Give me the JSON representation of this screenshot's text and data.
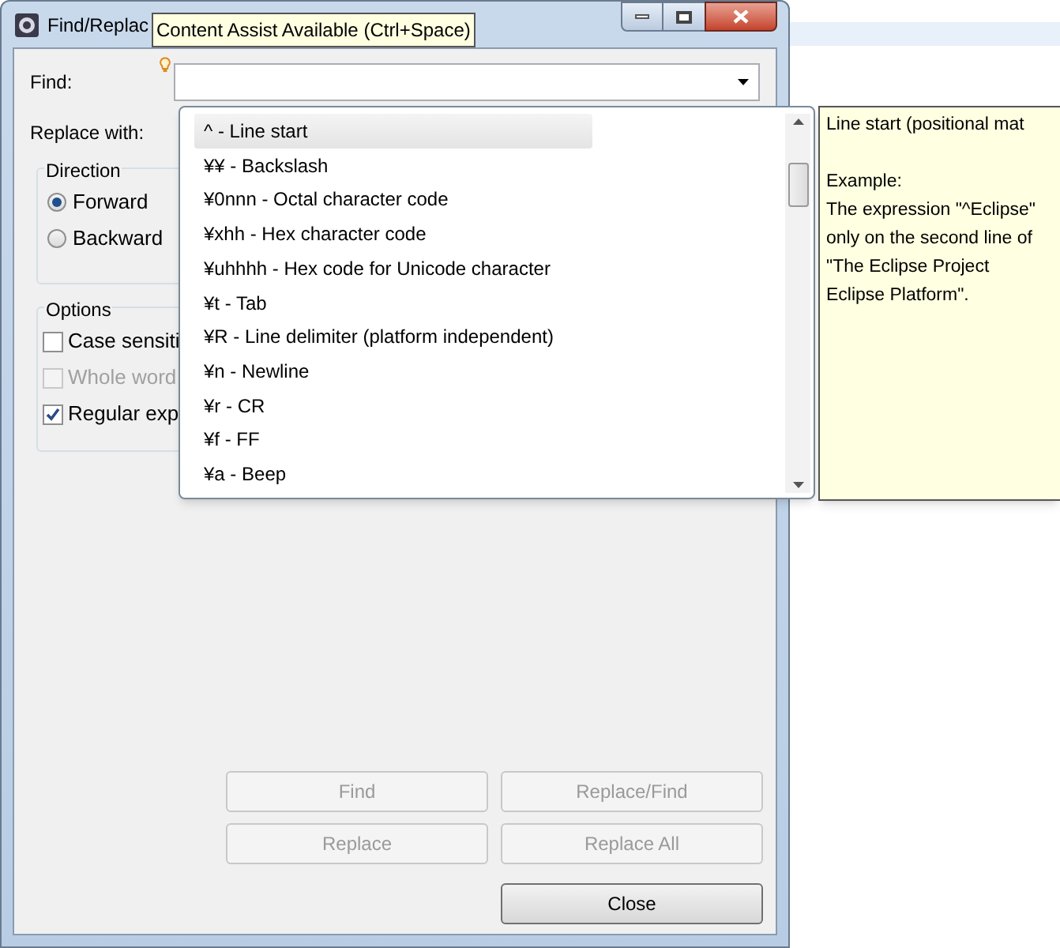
{
  "window": {
    "title": "Find/Replac"
  },
  "content_assist_tooltip": "Content Assist Available (Ctrl+Space)",
  "find": {
    "label": "Find:"
  },
  "replace": {
    "label": "Replace with:"
  },
  "direction": {
    "title": "Direction",
    "options": [
      {
        "label": "Forward",
        "selected": true
      },
      {
        "label": "Backward",
        "selected": false
      }
    ]
  },
  "options": {
    "title": "Options",
    "items": [
      {
        "label": "Case sensiti",
        "checked": false,
        "disabled": false
      },
      {
        "label": "Whole word",
        "checked": false,
        "disabled": true
      },
      {
        "label": "Regular exp",
        "checked": true,
        "disabled": false
      }
    ]
  },
  "buttons": [
    {
      "label": "Find",
      "disabled": true
    },
    {
      "label": "Replace/Find",
      "disabled": true
    },
    {
      "label": "Replace",
      "disabled": true
    },
    {
      "label": "Replace All",
      "disabled": true
    },
    {
      "label": "Close",
      "disabled": false
    }
  ],
  "proposals": [
    {
      "label": "^ - Line start",
      "selected": true
    },
    {
      "label": "¥¥ - Backslash",
      "selected": false
    },
    {
      "label": "¥0nnn - Octal character code",
      "selected": false
    },
    {
      "label": "¥xhh - Hex character code",
      "selected": false
    },
    {
      "label": "¥uhhhh - Hex code for Unicode character",
      "selected": false
    },
    {
      "label": "¥t - Tab",
      "selected": false
    },
    {
      "label": "¥R - Line delimiter (platform independent)",
      "selected": false
    },
    {
      "label": "¥n - Newline",
      "selected": false
    },
    {
      "label": "¥r - CR",
      "selected": false
    },
    {
      "label": "¥f - FF",
      "selected": false
    },
    {
      "label": "¥a - Beep",
      "selected": false
    }
  ],
  "proposal_doc": {
    "paragraphs": [
      {
        "lines": [
          "Line start (positional mat"
        ]
      },
      {
        "lines": [
          "Example:",
          "The expression \"^Eclipse\"",
          "only on the second line of",
          "\"The Eclipse Project",
          "Eclipse Platform\"."
        ]
      }
    ]
  }
}
